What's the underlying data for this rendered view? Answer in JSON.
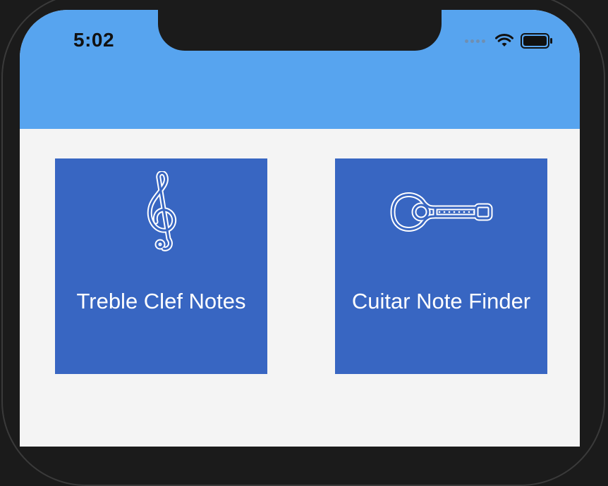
{
  "status_bar": {
    "time": "5:02",
    "icons": [
      "signal-dots-icon",
      "wifi-icon",
      "battery-icon"
    ]
  },
  "colors": {
    "header": "#57a4ef",
    "tile": "#3866c2",
    "background": "#f4f4f4"
  },
  "tiles": [
    {
      "label": "Treble Clef Notes",
      "icon": "treble-clef-icon"
    },
    {
      "label": "Cuitar Note Finder",
      "icon": "guitar-icon"
    }
  ]
}
